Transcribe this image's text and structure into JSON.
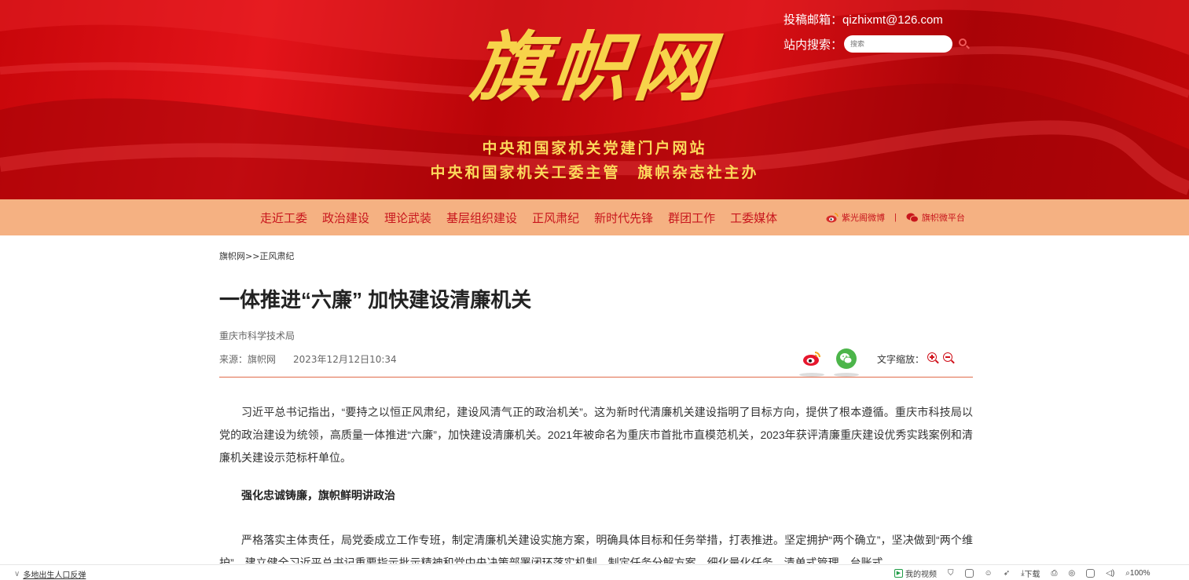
{
  "header": {
    "logo_text": "旗帜网",
    "tagline_1": "中央和国家机关党建门户网站",
    "tagline_2": "中央和国家机关工委主管　旗帜杂志社主办",
    "contact_label": "投稿邮箱：",
    "contact_email": "qizhixmt@126.com",
    "search_label": "站内搜索：",
    "search_placeholder": "搜索"
  },
  "nav": {
    "items": [
      "走近工委",
      "政治建设",
      "理论武装",
      "基层组织建设",
      "正风肃纪",
      "新时代先锋",
      "群团工作",
      "工委媒体"
    ],
    "social_weibo": "紫光阁微博",
    "social_separator": "|",
    "social_wechat": "旗帜微平台"
  },
  "article": {
    "breadcrumb": "旗帜网>>正风肃纪",
    "title": "一体推进“六廉” 加快建设清廉机关",
    "author": "重庆市科学技术局",
    "source": "来源：旗帜网",
    "date": "2023年12月12日10:34",
    "zoom_label": "文字缩放：",
    "paragraph_1": "习近平总书记指出，“要持之以恒正风肃纪，建设风清气正的政治机关”。这为新时代清廉机关建设指明了目标方向，提供了根本遵循。重庆市科技局以党的政治建设为统领，高质量一体推进“六廉”，加快建设清廉机关。2021年被命名为重庆市首批市直模范机关，2023年获评清廉重庆建设优秀实践案例和清廉机关建设示范标杆单位。",
    "subheading_1": "强化忠诚铸廉，旗帜鲜明讲政治",
    "paragraph_2": "严格落实主体责任，局党委成立工作专班，制定清廉机关建设实施方案，明确具体目标和任务举措，打表推进。坚定拥护“两个确立”，坚决做到“两个维护”，建立健全习近平总书记重要指示批示精神和党中央决策部署闭环落实机制，制定任务分解方案，细化量化任务，清单式管理，台账式"
  },
  "statusbar": {
    "left_link": "多地出生人口反弹",
    "my_video": "我的视频",
    "download": "下载",
    "zoom": "100%"
  },
  "colors": {
    "banner_red": "#c8060a",
    "gold": "#fbd85b",
    "nav_bg": "#f5b182",
    "nav_text": "#c8161d",
    "divider": "#e06b4a"
  }
}
